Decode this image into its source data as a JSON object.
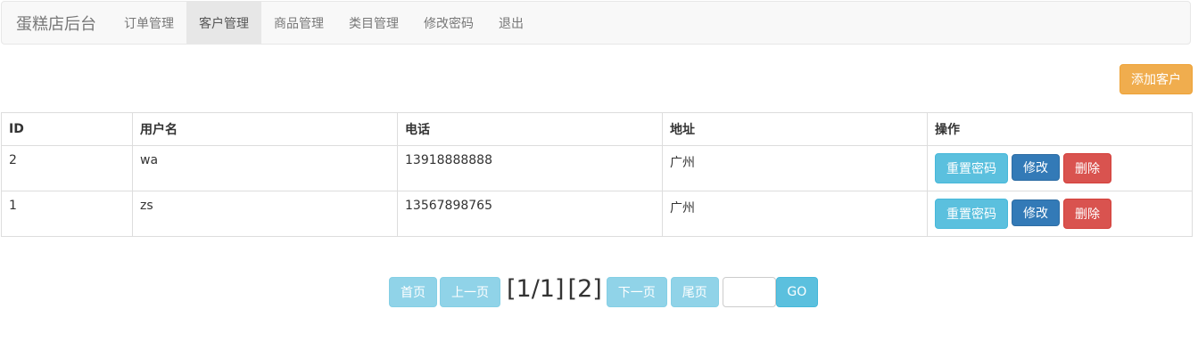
{
  "navbar": {
    "brand": "蛋糕店后台",
    "items": [
      {
        "label": "订单管理",
        "active": false
      },
      {
        "label": "客户管理",
        "active": true
      },
      {
        "label": "商品管理",
        "active": false
      },
      {
        "label": "类目管理",
        "active": false
      },
      {
        "label": "修改密码",
        "active": false
      },
      {
        "label": "退出",
        "active": false
      }
    ]
  },
  "toolbar": {
    "add_label": "添加客户"
  },
  "table": {
    "headers": [
      "ID",
      "用户名",
      "电话",
      "地址",
      "操作"
    ],
    "rows": [
      {
        "id": "2",
        "username": "wa",
        "phone": "13918888888",
        "address": "广州"
      },
      {
        "id": "1",
        "username": "zs",
        "phone": "13567898765",
        "address": "广州"
      }
    ],
    "actions": {
      "reset": "重置密码",
      "edit": "修改",
      "delete": "删除"
    }
  },
  "pagination": {
    "first": "首页",
    "prev": "上一页",
    "current": "[1/1]",
    "page_link": "[2]",
    "next": "下一页",
    "last": "尾页",
    "input_value": "",
    "go": "GO"
  },
  "colors": {
    "warning": "#f0ad4e",
    "info": "#5bc0de",
    "primary": "#337ab7",
    "danger": "#d9534f"
  }
}
